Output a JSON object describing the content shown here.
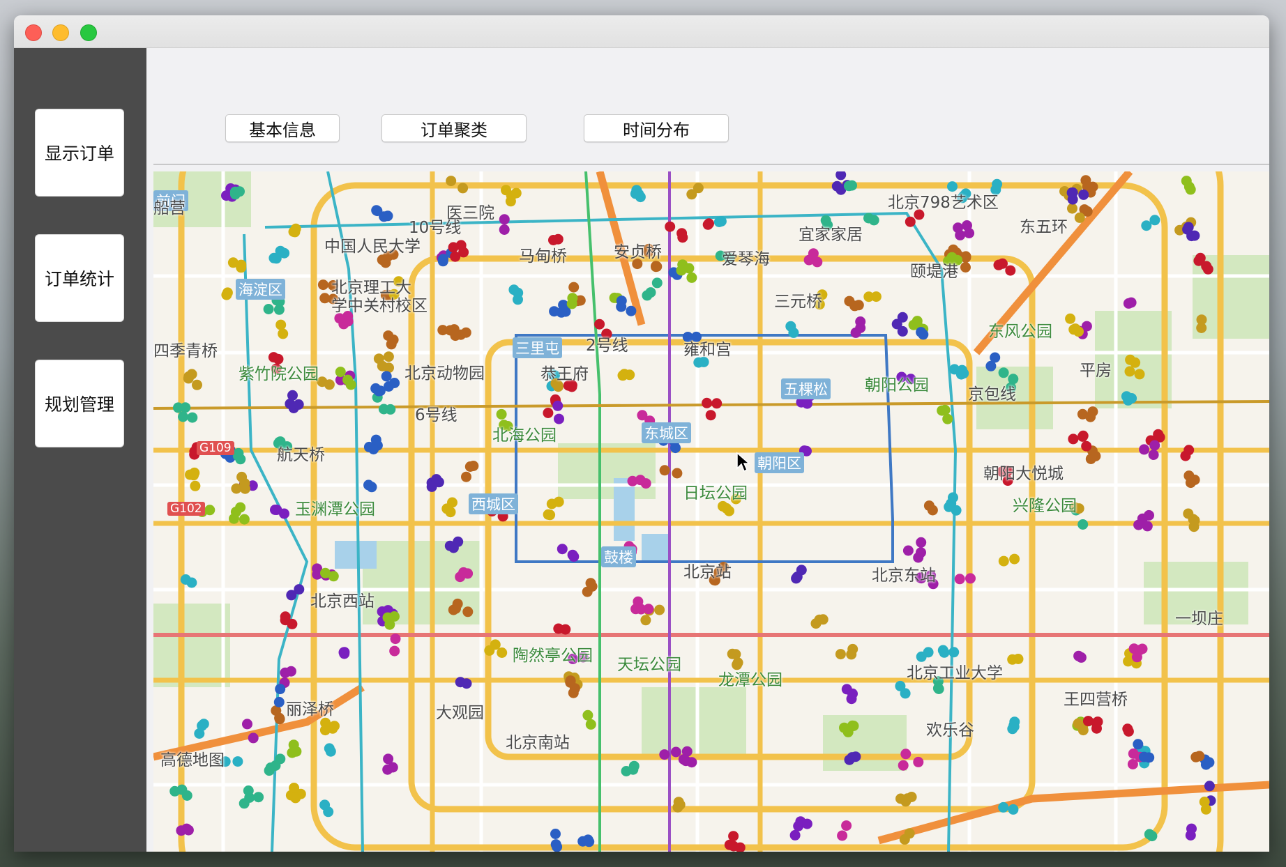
{
  "sidebar": {
    "buttons": [
      "显示订单",
      "订单统计",
      "规划管理"
    ]
  },
  "tabs": [
    "基本信息",
    "订单聚类",
    "时间分布"
  ],
  "map": {
    "labels": [
      {
        "text": "中国人民大学",
        "kind": "poi"
      },
      {
        "text": "北京理工大",
        "kind": "poi"
      },
      {
        "text": "学中关村校区",
        "kind": "poi"
      },
      {
        "text": "医三院",
        "kind": "poi"
      },
      {
        "text": "马甸桥",
        "kind": "poi"
      },
      {
        "text": "安贞桥",
        "kind": "poi"
      },
      {
        "text": "北京798艺术区",
        "kind": "poi"
      },
      {
        "text": "宜家家居",
        "kind": "poi"
      },
      {
        "text": "爱琴海",
        "kind": "poi"
      },
      {
        "text": "颐堤港",
        "kind": "poi"
      },
      {
        "text": "三元桥",
        "kind": "poi"
      },
      {
        "text": "东风公园",
        "kind": "park"
      },
      {
        "text": "海淀区",
        "kind": "district"
      },
      {
        "text": "四季青桥",
        "kind": "poi"
      },
      {
        "text": "紫竹院公园",
        "kind": "park"
      },
      {
        "text": "北京动物园",
        "kind": "poi"
      },
      {
        "text": "恭王府",
        "kind": "poi"
      },
      {
        "text": "雍和宫",
        "kind": "poi"
      },
      {
        "text": "朝阳公园",
        "kind": "park"
      },
      {
        "text": "平房",
        "kind": "poi"
      },
      {
        "text": "北海公园",
        "kind": "park"
      },
      {
        "text": "东城区",
        "kind": "district"
      },
      {
        "text": "航天桥",
        "kind": "poi"
      },
      {
        "text": "朝阳区",
        "kind": "district"
      },
      {
        "text": "朝阳大悦城",
        "kind": "poi"
      },
      {
        "text": "玉渊潭公园",
        "kind": "park"
      },
      {
        "text": "日坛公园",
        "kind": "park"
      },
      {
        "text": "西城区",
        "kind": "district"
      },
      {
        "text": "兴隆公园",
        "kind": "park"
      },
      {
        "text": "北京站",
        "kind": "poi"
      },
      {
        "text": "北京东站",
        "kind": "poi"
      },
      {
        "text": "北京西站",
        "kind": "poi"
      },
      {
        "text": "一坝庄",
        "kind": "poi"
      },
      {
        "text": "陶然亭公园",
        "kind": "park"
      },
      {
        "text": "天坛公园",
        "kind": "park"
      },
      {
        "text": "龙潭公园",
        "kind": "park"
      },
      {
        "text": "北京工业大学",
        "kind": "poi"
      },
      {
        "text": "丽泽桥",
        "kind": "poi"
      },
      {
        "text": "大观园",
        "kind": "poi"
      },
      {
        "text": "王四营桥",
        "kind": "poi"
      },
      {
        "text": "欢乐谷",
        "kind": "poi"
      },
      {
        "text": "北京南站",
        "kind": "poi"
      },
      {
        "text": "G109",
        "kind": "road"
      },
      {
        "text": "G102",
        "kind": "road"
      },
      {
        "text": "五棵松",
        "kind": "district"
      },
      {
        "text": "三里屯",
        "kind": "district"
      },
      {
        "text": "鼓楼",
        "kind": "district"
      },
      {
        "text": "前门",
        "kind": "district"
      },
      {
        "text": "10号线",
        "kind": "poi"
      },
      {
        "text": "2号线",
        "kind": "poi"
      },
      {
        "text": "6号线",
        "kind": "poi"
      },
      {
        "text": "船营",
        "kind": "poi"
      },
      {
        "text": "京包线",
        "kind": "poi"
      },
      {
        "text": "东五环",
        "kind": "poi"
      },
      {
        "text": "高德地图",
        "kind": "poi"
      }
    ],
    "cluster_colors": [
      "#d4b10f",
      "#2ab0c4",
      "#c8182c",
      "#4f28b4",
      "#9e1fa8",
      "#b7661f",
      "#8fbf1c",
      "#2a5fc4",
      "#c82a9a",
      "#2fb48a",
      "#7a1fbf",
      "#c49a1f"
    ]
  }
}
